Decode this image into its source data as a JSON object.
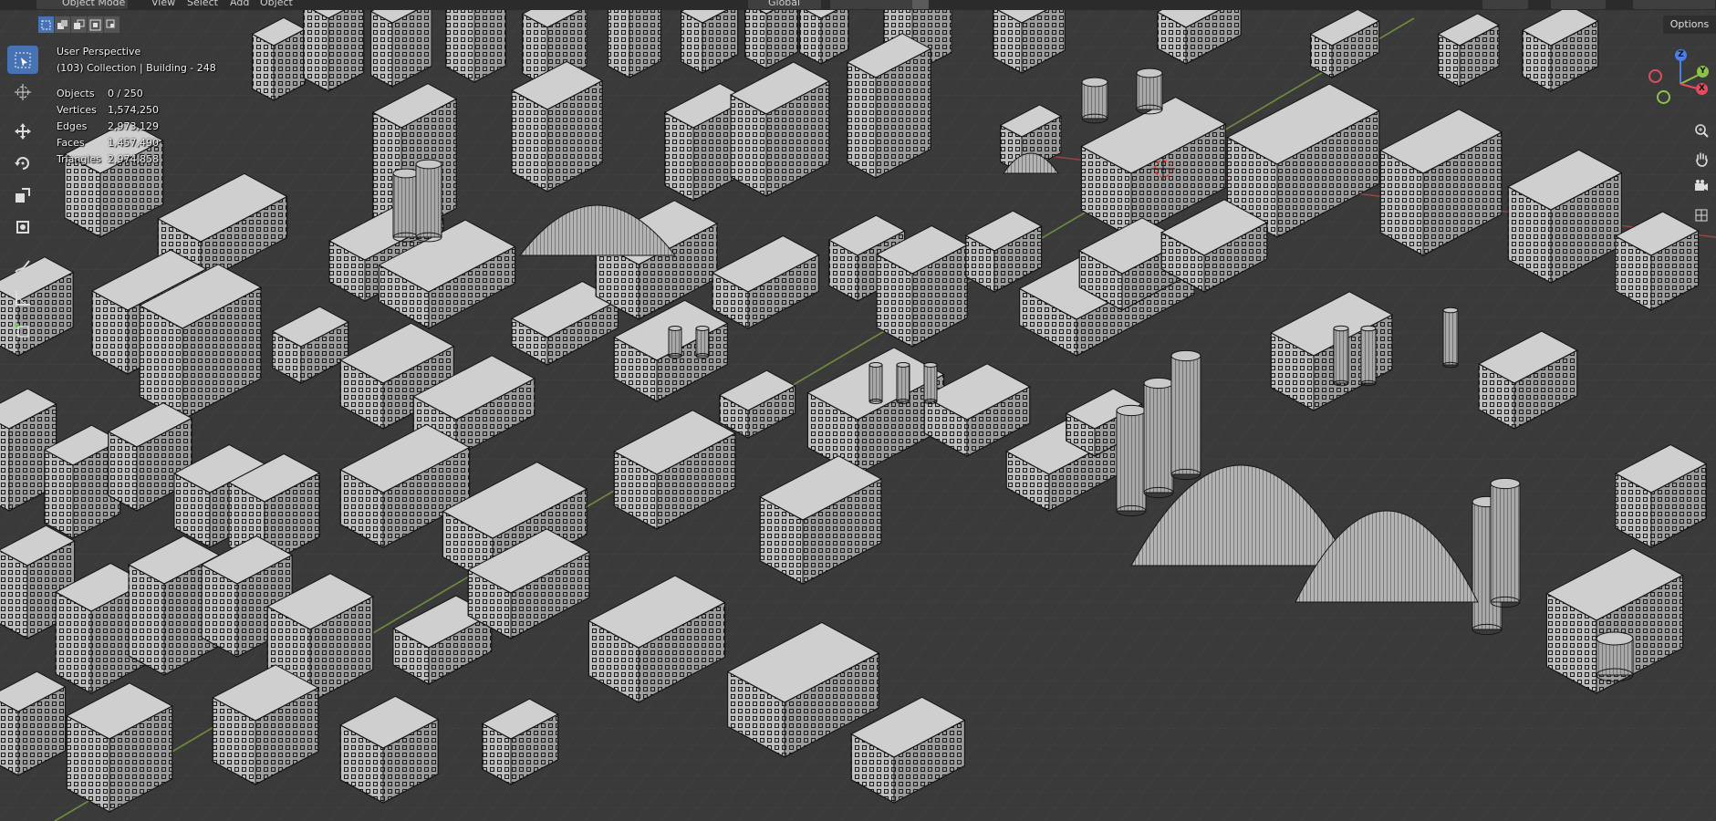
{
  "header": {
    "mode": "Object Mode",
    "menus": [
      "View",
      "Select",
      "Add",
      "Object"
    ],
    "orientation": "Global"
  },
  "options_label": "Options",
  "overlay": {
    "view_name": "User Perspective",
    "collection": "(103) Collection | Building - 248",
    "stats": [
      {
        "label": "Objects",
        "value": "0 / 250"
      },
      {
        "label": "Vertices",
        "value": "1,574,250"
      },
      {
        "label": "Edges",
        "value": "2,973,129"
      },
      {
        "label": "Faces",
        "value": "1,457,490"
      },
      {
        "label": "Triangles",
        "value": "2,974,858"
      }
    ]
  },
  "gizmo": {
    "z": "Z",
    "y": "Y",
    "x": "X"
  },
  "colors": {
    "accent": "#4772b3",
    "grid_bg": "#3a3a3a",
    "axis_x": "#c84b4b",
    "axis_y": "#7da43a",
    "gizmo_x": "#e84a5f",
    "gizmo_y": "#8bc34a",
    "gizmo_z": "#4a7fe8"
  },
  "icons": [
    "select-box-icon",
    "cursor-icon",
    "move-icon",
    "rotate-icon",
    "scale-icon",
    "transform-icon",
    "annotate-icon",
    "measure-icon",
    "add-cube-icon",
    "zoom-icon",
    "pan-hand-icon",
    "camera-icon",
    "grid-view-icon"
  ]
}
